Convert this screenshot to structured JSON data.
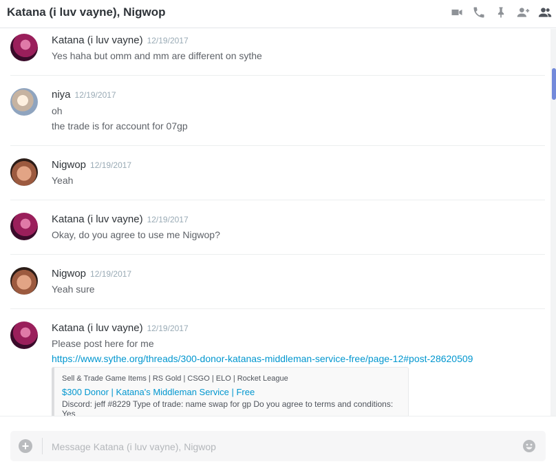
{
  "header": {
    "title": "Katana (i luv vayne), Nigwop",
    "toolbar": [
      {
        "icon": "video-camera-icon"
      },
      {
        "icon": "phone-icon"
      },
      {
        "icon": "pin-icon"
      },
      {
        "icon": "add-friend-icon"
      },
      {
        "icon": "member-list-icon"
      }
    ]
  },
  "messages": [
    {
      "author": "Katana (i luv vayne)",
      "timestamp": "12/19/2017",
      "avatar": "katana-avatar",
      "lines": [
        "Yes haha but omm and mm are different on sythe"
      ]
    },
    {
      "author": "niya",
      "timestamp": "12/19/2017",
      "avatar": "niya-avatar",
      "lines": [
        "oh",
        "the trade is for account for 07gp"
      ]
    },
    {
      "author": "Nigwop",
      "timestamp": "12/19/2017",
      "avatar": "nigwop-avatar",
      "lines": [
        "Yeah"
      ]
    },
    {
      "author": "Katana (i luv vayne)",
      "timestamp": "12/19/2017",
      "avatar": "katana-avatar",
      "lines": [
        "Okay, do you agree to use me Nigwop?"
      ]
    },
    {
      "author": "Nigwop",
      "timestamp": "12/19/2017",
      "avatar": "nigwop-avatar",
      "lines": [
        "Yeah sure"
      ]
    },
    {
      "author": "Katana (i luv vayne)",
      "timestamp": "12/19/2017",
      "avatar": "katana-avatar",
      "lines": [
        "Please post here for me"
      ],
      "link": "https://www.sythe.org/threads/300-donor-katanas-middleman-service-free/page-12#post-28620509",
      "embed": {
        "provider": "Sell & Trade Game Items | RS Gold | CSGO | ELO | Rocket League",
        "title": "$300 Donor | Katana's Middleman Service | Free",
        "description": "Discord: jeff #8229 Type of trade: name swap for gp Do you agree to terms and conditions: Yes"
      }
    }
  ],
  "composer": {
    "placeholder": "Message Katana (i luv vayne), Nigwop",
    "value": ""
  },
  "colors": {
    "link": "#0096cf",
    "scroll_thumb": "#7289da",
    "timestamp": "#99aab5"
  }
}
